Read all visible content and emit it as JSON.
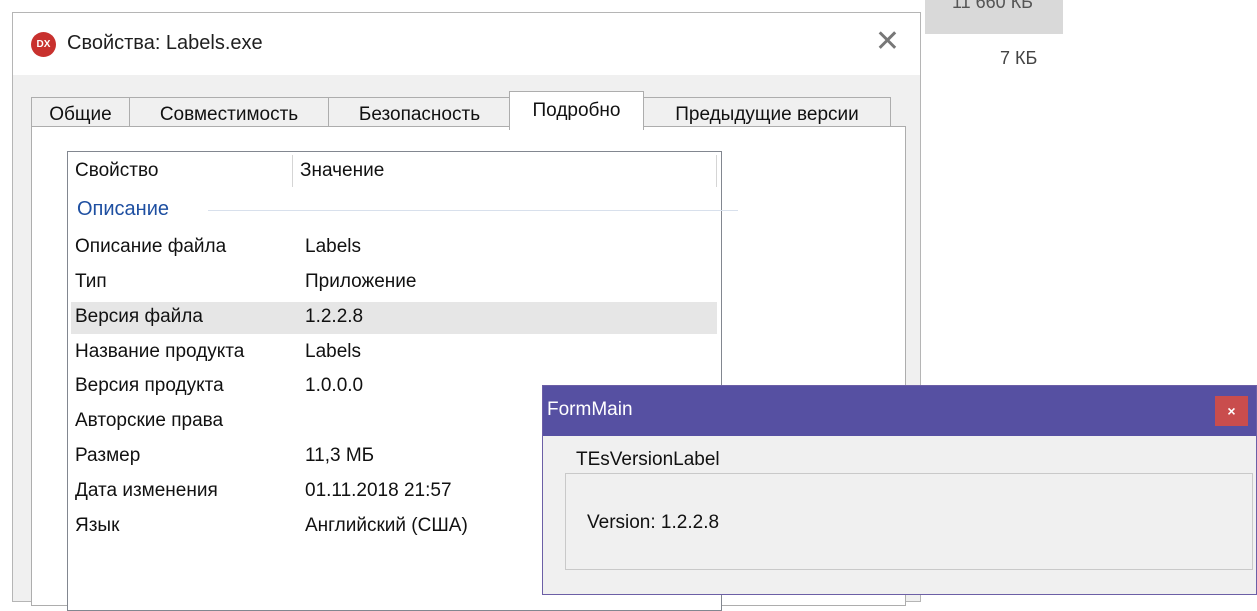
{
  "background": {
    "size_row1": "11 660 КБ",
    "size_row2": "7 КБ"
  },
  "dialog": {
    "app_icon_text": "DX",
    "title": "Свойства: Labels.exe",
    "close_glyph": "✕",
    "tabs": [
      {
        "label": "Общие"
      },
      {
        "label": "Совместимость"
      },
      {
        "label": "Безопасность"
      },
      {
        "label": "Подробно",
        "active": true
      },
      {
        "label": "Предыдущие версии"
      }
    ],
    "list": {
      "col_property": "Свойство",
      "col_value": "Значение",
      "group": "Описание",
      "rows": [
        {
          "prop": "Описание файла",
          "val": "Labels"
        },
        {
          "prop": "Тип",
          "val": "Приложение"
        },
        {
          "prop": "Версия файла",
          "val": "1.2.2.8",
          "selected": true
        },
        {
          "prop": "Название продукта",
          "val": "Labels"
        },
        {
          "prop": "Версия продукта",
          "val": "1.0.0.0"
        },
        {
          "prop": "Авторские права",
          "val": ""
        },
        {
          "prop": "Размер",
          "val": "11,3 МБ"
        },
        {
          "prop": "Дата изменения",
          "val": "01.11.2018 21:57"
        },
        {
          "prop": "Язык",
          "val": "Английский (США)"
        }
      ]
    }
  },
  "form": {
    "title": "FormMain",
    "close_glyph": "×",
    "groupbox_title": "TEsVersionLabel",
    "version_label": "Version: 1.2.2.8"
  },
  "colors": {
    "form_titlebar": "#5650a2",
    "form_close": "#c94d4d",
    "group_title": "#1e4fa1",
    "app_icon": "#c8312e"
  }
}
